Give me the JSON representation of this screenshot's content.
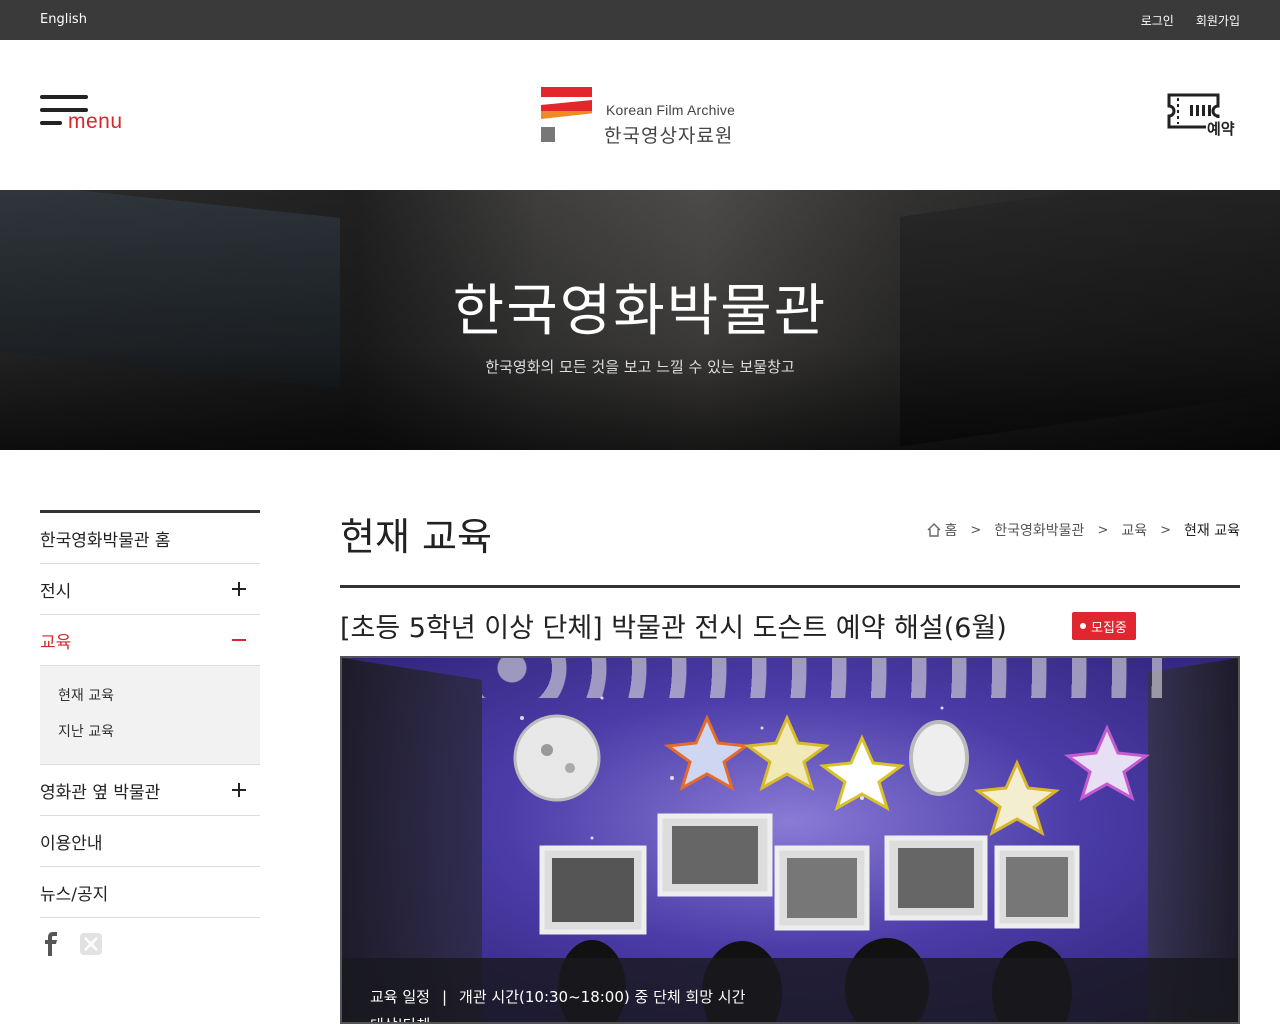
{
  "topbar": {
    "language_label": "English",
    "login_label": "로그인",
    "signup_label": "회원가입"
  },
  "header": {
    "menu_label": "menu",
    "logo_en": "Korean Film Archive",
    "logo_ko": "한국영상자료원",
    "reserve_label": "예약"
  },
  "hero": {
    "title": "한국영화박물관",
    "subtitle": "한국영화의 모든 것을 보고 느낄 수 있는 보물창고"
  },
  "sidebar": {
    "items": [
      {
        "label": "한국영화박물관 홈"
      },
      {
        "label": "전시"
      },
      {
        "label": "교육"
      },
      {
        "label": "영화관 옆 박물관"
      },
      {
        "label": "이용안내"
      },
      {
        "label": "뉴스/공지"
      }
    ],
    "sub_items": [
      {
        "label": "현재 교육"
      },
      {
        "label": "지난 교육"
      }
    ]
  },
  "page": {
    "title": "현재 교육",
    "breadcrumb": [
      "홈",
      "한국영화박물관",
      "교육",
      "현재 교육"
    ]
  },
  "post": {
    "title": "[초등 5학년 이상 단체] 박물관 전시 도슨트 예약 해설(6월)",
    "status_badge": "모집중",
    "schedule_key": "교육 일정",
    "schedule_value": "개관 시간(10:30~18:00) 중 단체 희망 시간",
    "target_key": "대상",
    "target_value": "단체"
  },
  "colors": {
    "accent": "#d7262c",
    "topbar_bg": "#3a3a3a",
    "badge": "#e0262e"
  }
}
